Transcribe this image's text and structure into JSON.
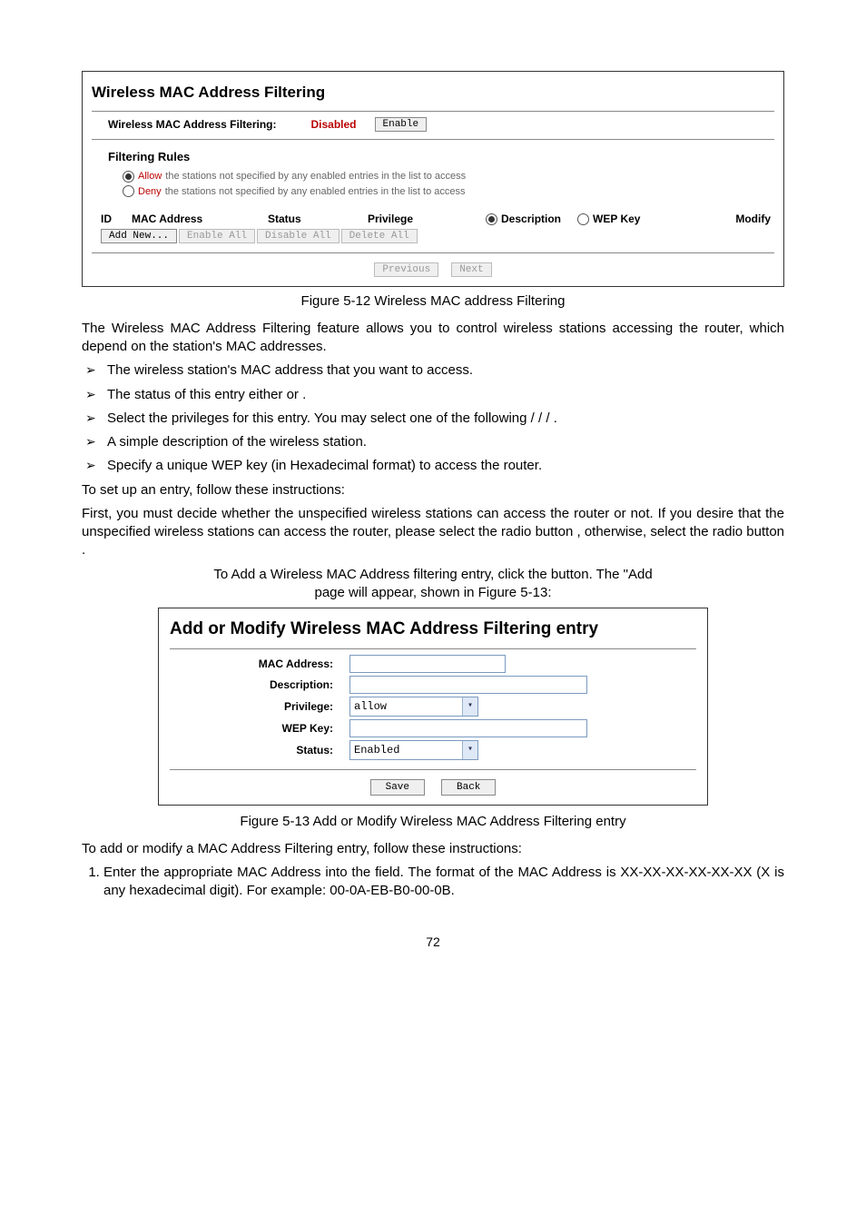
{
  "panel1": {
    "title": "Wireless MAC Address Filtering",
    "status_label": "Wireless MAC Address Filtering:",
    "status_value": "Disabled",
    "enable_btn": "Enable",
    "rules_heading": "Filtering Rules",
    "rule_allow_word": "Allow",
    "rule_allow_rest": " the stations not specified by any enabled entries in the list to access",
    "rule_deny_word": "Deny",
    "rule_deny_rest": " the stations not specified by any enabled entries in the list to access",
    "hdr_id": "ID",
    "hdr_mac": "MAC Address",
    "hdr_status": "Status",
    "hdr_priv": "Privilege",
    "hdr_desc": "Description",
    "hdr_wep": "WEP Key",
    "hdr_modify": "Modify",
    "btn_add": "Add New...",
    "btn_enall": "Enable All",
    "btn_disall": "Disable All",
    "btn_delall": "Delete All",
    "btn_prev": "Previous",
    "btn_next": "Next"
  },
  "caption1": "Figure 5-12 Wireless MAC address Filtering",
  "para1": "The Wireless MAC Address Filtering feature allows you to control wireless stations accessing the router, which depend on the station's MAC addresses.",
  "bullets": {
    "mac": "The wireless station's MAC address that you want to access.",
    "status_a": "The status of this entry either ",
    "status_b": " or ",
    "status_c": ".",
    "priv_a": "Select the privileges for this entry.   You may select one of the following ",
    "priv_b": " / ",
    "priv_c": " / ",
    "priv_d": " / ",
    "priv_e": ".",
    "desc": "A simple description of the wireless station.",
    "wep": "Specify a unique WEP key (in Hexadecimal format) to access the router."
  },
  "para2": "To set up an entry, follow these instructions:",
  "para3a": "First, you must decide whether the unspecified wireless stations can access the router or not. If you desire that the unspecified wireless stations can access the router, please select the radio button ",
  "para3b": ", otherwise, select the radio button ",
  "para3c": ".",
  "para4a": "To Add a Wireless MAC Address filtering entry, click the ",
  "para4b": " button. The \"Add ",
  "para4c": " page will appear, shown in Figure 5-13:",
  "panel2": {
    "title": "Add or Modify Wireless MAC Address Filtering entry",
    "mac_label": "MAC Address:",
    "desc_label": "Description:",
    "priv_label": "Privilege:",
    "priv_value": "allow",
    "wep_label": "WEP Key:",
    "status_label": "Status:",
    "status_value": "Enabled",
    "btn_save": "Save",
    "btn_back": "Back"
  },
  "caption2": "Figure 5-13 Add or Modify Wireless MAC Address Filtering entry",
  "para5": "To add or modify a MAC Address Filtering entry, follow these instructions:",
  "ol1_a": "Enter the appropriate MAC Address into the ",
  "ol1_b": " field. The format of the MAC Address is XX-XX-XX-XX-XX-XX (X is any hexadecimal digit). For example: 00-0A-EB-B0-00-0B.",
  "pagenum": "72"
}
